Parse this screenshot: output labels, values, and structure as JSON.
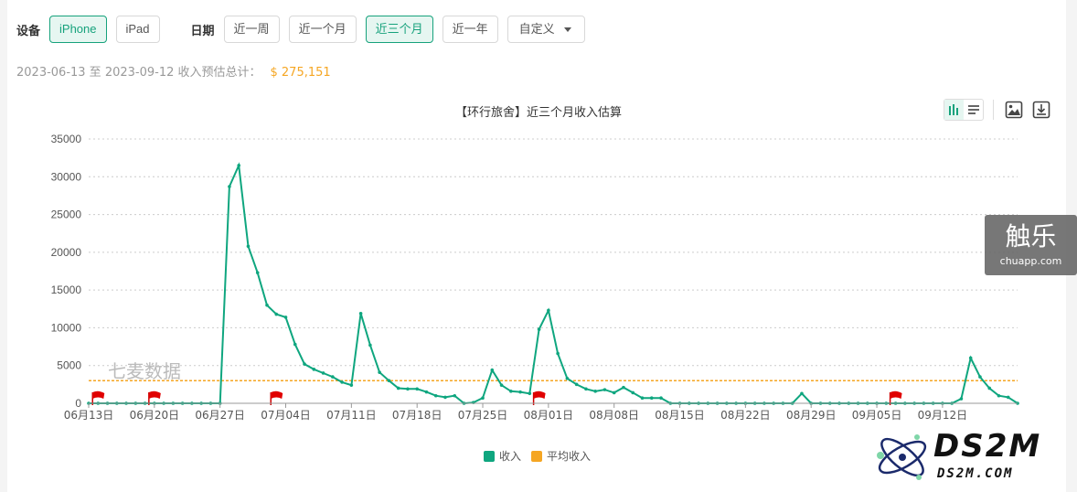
{
  "filters": {
    "device_label": "设备",
    "device_options": [
      "iPhone",
      "iPad"
    ],
    "device_active": "iPhone",
    "date_label": "日期",
    "date_options": [
      "近一周",
      "近一个月",
      "近三个月",
      "近一年"
    ],
    "date_active": "近三个月",
    "custom_label": "自定义"
  },
  "summary": {
    "range_text": "2023-06-13 至 2023-09-12 收入预估总计：",
    "total": "$ 275,151"
  },
  "watermarks": {
    "chart_text": "七麦数据",
    "badge_big": "触乐",
    "badge_small": "chuapp.com",
    "logo_brand": "DS2M",
    "logo_site": "DS2M.COM"
  },
  "icons": [
    "bar-chart-icon",
    "list-icon",
    "image-icon",
    "download-icon",
    "flag-icon",
    "caret-down-icon"
  ],
  "colors": {
    "accent": "#16a27c",
    "series_income": "#0fa67f",
    "series_average": "#f5a623",
    "flag": "#e00000"
  },
  "chart_data": {
    "type": "line",
    "title": "【环行旅舍】近三个月收入估算",
    "start_date": "2023-06-13",
    "x_tick_labels": [
      "06月13日",
      "06月20日",
      "06月27日",
      "07月04日",
      "07月11日",
      "07月18日",
      "07月25日",
      "08月01日",
      "08月08日",
      "08月15日",
      "08月22日",
      "08月29日",
      "09月05日",
      "09月12日"
    ],
    "y_ticks": [
      0,
      5000,
      10000,
      15000,
      20000,
      25000,
      30000,
      35000
    ],
    "ylim": [
      0,
      35000
    ],
    "grid": true,
    "legend_position": "bottom-center",
    "flag_dates": [
      "06月14日",
      "06月20日",
      "07月03日",
      "07月31日",
      "09月07日"
    ],
    "series": [
      {
        "name": "收入",
        "values": [
          0,
          0,
          0,
          0,
          0,
          0,
          0,
          0,
          0,
          0,
          0,
          0,
          0,
          0,
          0,
          28700,
          31500,
          20800,
          17300,
          13000,
          11800,
          11400,
          7800,
          5200,
          4500,
          4000,
          3500,
          2800,
          2400,
          11900,
          7700,
          4100,
          3000,
          2000,
          1900,
          1900,
          1500,
          1000,
          800,
          1000,
          0,
          100,
          700,
          4400,
          2400,
          1600,
          1500,
          1300,
          9800,
          12300,
          6600,
          3300,
          2500,
          1900,
          1600,
          1800,
          1400,
          2100,
          1400,
          700,
          700,
          700,
          0,
          0,
          0,
          0,
          0,
          0,
          0,
          0,
          0,
          0,
          0,
          0,
          0,
          0,
          1300,
          0,
          0,
          0,
          0,
          0,
          0,
          0,
          0,
          0,
          0,
          0,
          0,
          0,
          0,
          0,
          0,
          600,
          6000,
          3500,
          2000,
          1000,
          800,
          0
        ]
      },
      {
        "name": "平均收入",
        "values": [
          3000
        ]
      }
    ]
  }
}
